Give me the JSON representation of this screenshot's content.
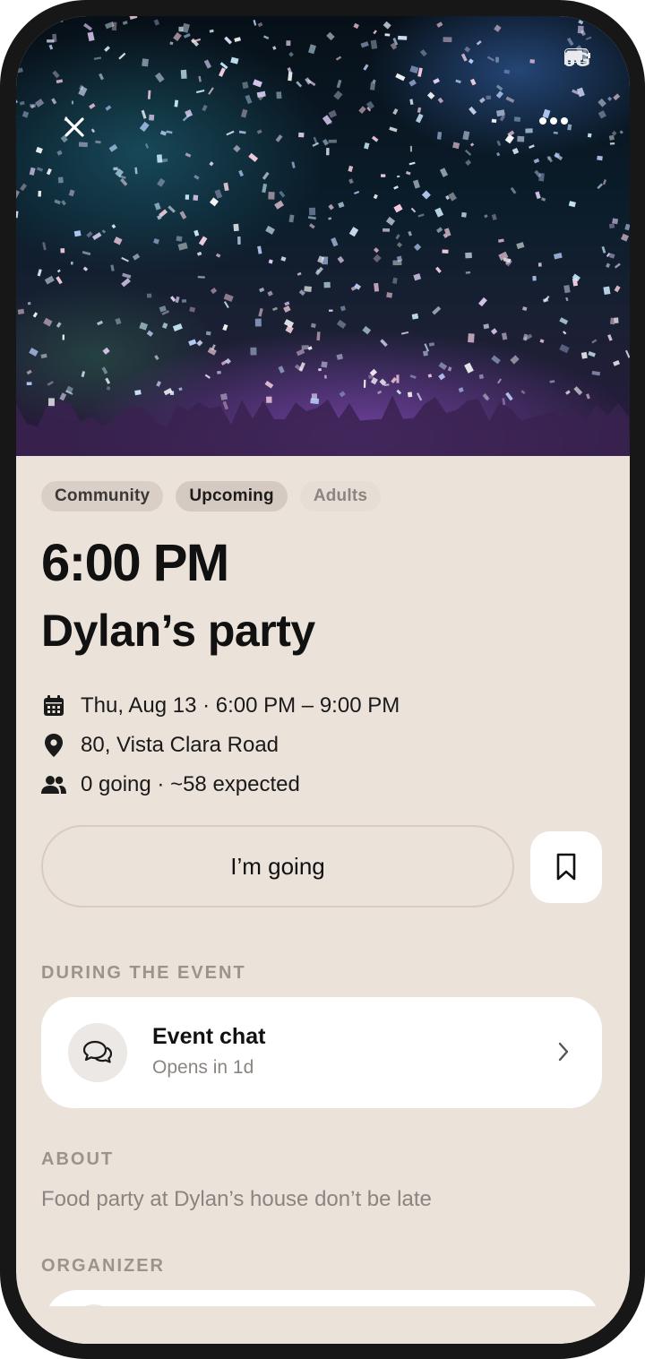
{
  "status_bar": {
    "network": "5G"
  },
  "hero": {
    "close_icon": "close-icon",
    "more_icon": "more-horizontal-icon"
  },
  "tags": [
    "Community",
    "Upcoming",
    "Adults"
  ],
  "event": {
    "time": "6:00 PM",
    "title": "Dylan’s party",
    "date_line": "Thu, Aug 13 · 6:00 PM – 9:00 PM",
    "address": "80, Vista Clara Road",
    "attendance": "0 going · ~58 expected"
  },
  "actions": {
    "going_label": "I’m going",
    "bookmark_icon": "bookmark-icon"
  },
  "during_event": {
    "section_title": "DURING THE EVENT",
    "chat_title": "Event chat",
    "chat_subtitle": "Opens in 1d"
  },
  "about": {
    "section_title": "ABOUT",
    "text": "Food party at Dylan’s house don’t be late"
  },
  "organizer": {
    "section_title": "ORGANIZER"
  },
  "colors": {
    "background": "#ebe2da",
    "card": "#ffffff",
    "text": "#111111",
    "muted": "#8a8581"
  }
}
